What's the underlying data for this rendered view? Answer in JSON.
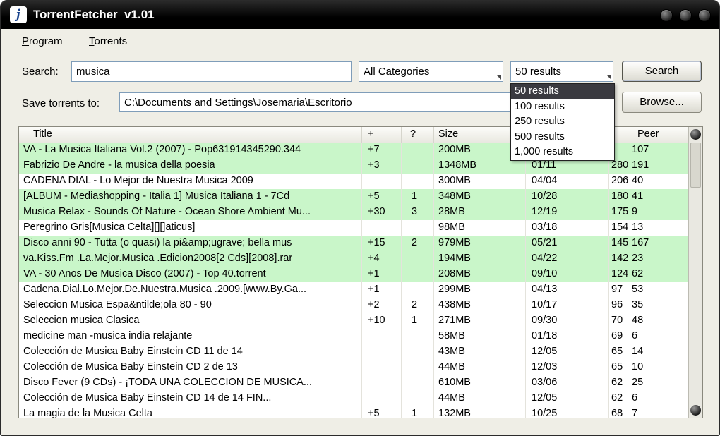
{
  "window": {
    "title": "TorrentFetcher  v1.01",
    "icon_letter": "j"
  },
  "menu": {
    "program": "Program",
    "torrents": "Torrents"
  },
  "search_row": {
    "label": "Search:",
    "query": "musica",
    "category": "All Categories",
    "results": "50 results",
    "button": "Search"
  },
  "save_row": {
    "label": "Save torrents to:",
    "path": "C:\\Documents and Settings\\Josemaria\\Escritorio",
    "button": "Browse..."
  },
  "results_dropdown": {
    "options": [
      "50 results",
      "100 results",
      "250 results",
      "500 results",
      "1,000 results"
    ],
    "selected_index": 0
  },
  "table": {
    "columns": [
      "Title",
      "+",
      "?",
      "Size",
      "",
      "",
      "Peer"
    ],
    "rows": [
      {
        "title": "VA - La Musica Italiana Vol.2 (2007) - Pop631914345290.344",
        "plus": "+7",
        "q": "",
        "size": "200MB",
        "date": "",
        "seed": "",
        "peer": "107",
        "green": true
      },
      {
        "title": "Fabrizio De Andre - la musica della poesia",
        "plus": "+3",
        "q": "",
        "size": "1348MB",
        "date": "01/11",
        "seed": "280",
        "peer": "191",
        "green": true
      },
      {
        "title": "CADENA DIAL - Lo Mejor de Nuestra Musica 2009",
        "plus": "",
        "q": "",
        "size": "300MB",
        "date": "04/04",
        "seed": "206",
        "peer": "40",
        "green": false
      },
      {
        "title": "[ALBUM - Mediashopping - Italia 1] Musica Italiana 1 - 7Cd",
        "plus": "+5",
        "q": "1",
        "size": "348MB",
        "date": "10/28",
        "seed": "180",
        "peer": "41",
        "green": true
      },
      {
        "title": "Musica Relax - Sounds Of Nature - Ocean Shore Ambient Mu...",
        "plus": "+30",
        "q": "3",
        "size": "28MB",
        "date": "12/19",
        "seed": "175",
        "peer": "9",
        "green": true
      },
      {
        "title": "Peregrino Gris[Musica Celta][][]aticus]",
        "plus": "",
        "q": "",
        "size": "98MB",
        "date": "03/18",
        "seed": "154",
        "peer": "13",
        "green": false
      },
      {
        "title": "Disco anni 90 - Tutta (o quasi) la pi&amp;ugrave; bella mus",
        "plus": "+15",
        "q": "2",
        "size": "979MB",
        "date": "05/21",
        "seed": "145",
        "peer": "167",
        "green": true
      },
      {
        "title": "va.Kiss.Fm .La.Mejor.Musica .Edicion2008[2 Cds][2008].rar",
        "plus": "+4",
        "q": "",
        "size": "194MB",
        "date": "04/22",
        "seed": "142",
        "peer": "23",
        "green": true
      },
      {
        "title": "VA - 30 Anos De Musica Disco (2007) - Top 40.torrent",
        "plus": "+1",
        "q": "",
        "size": "208MB",
        "date": "09/10",
        "seed": "124",
        "peer": "62",
        "green": true
      },
      {
        "title": "Cadena.Dial.Lo.Mejor.De.Nuestra.Musica .2009.[www.By.Ga...",
        "plus": "+1",
        "q": "",
        "size": "299MB",
        "date": "04/13",
        "seed": "97",
        "peer": "53",
        "green": false
      },
      {
        "title": "Seleccion Musica Espa&ntilde;ola 80 - 90",
        "plus": "+2",
        "q": "2",
        "size": "438MB",
        "date": "10/17",
        "seed": "96",
        "peer": "35",
        "green": false
      },
      {
        "title": "Seleccion musica Clasica",
        "plus": "+10",
        "q": "1",
        "size": "271MB",
        "date": "09/30",
        "seed": "70",
        "peer": "48",
        "green": false
      },
      {
        "title": "medicine man -musica india relajante",
        "plus": "",
        "q": "",
        "size": "58MB",
        "date": "01/18",
        "seed": "69",
        "peer": "6",
        "green": false
      },
      {
        "title": "Colección de Musica Baby Einstein CD 11 de 14",
        "plus": "",
        "q": "",
        "size": "43MB",
        "date": "12/05",
        "seed": "65",
        "peer": "14",
        "green": false
      },
      {
        "title": "Colección de Musica Baby Einstein CD 2 de 13",
        "plus": "",
        "q": "",
        "size": "44MB",
        "date": "12/03",
        "seed": "65",
        "peer": "10",
        "green": false
      },
      {
        "title": "Disco Fever (9 CDs) - ¡TODA UNA COLECCION DE MUSICA...",
        "plus": "",
        "q": "",
        "size": "610MB",
        "date": "03/06",
        "seed": "62",
        "peer": "25",
        "green": false
      },
      {
        "title": "Colección de Musica Baby Einstein CD 14 de 14 FIN...",
        "plus": "",
        "q": "",
        "size": "44MB",
        "date": "12/05",
        "seed": "62",
        "peer": "6",
        "green": false
      },
      {
        "title": "La magia de la Musica Celta",
        "plus": "+5",
        "q": "1",
        "size": "132MB",
        "date": "10/25",
        "seed": "68",
        "peer": "7",
        "green": false
      }
    ]
  }
}
